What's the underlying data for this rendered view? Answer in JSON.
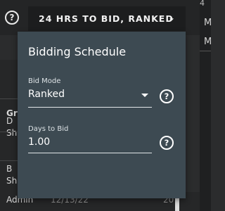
{
  "header": {
    "help_glyph": "?",
    "bid_button_label": "24 HRS TO BID, RANKED",
    "bid_button_chevron": "⌄"
  },
  "popup": {
    "title": "Bidding Schedule",
    "bid_mode": {
      "label": "Bid Mode",
      "value": "Ranked",
      "help_glyph": "?"
    },
    "days_to_bid": {
      "label": "Days to Bid",
      "value": "1.00",
      "help_glyph": "?"
    }
  },
  "background": {
    "left_column": {
      "header": "Gro",
      "rows": [
        {
          "line1": "D",
          "line2": "Sh"
        },
        {
          "line1": "B",
          "line2": "Sh"
        }
      ],
      "bottom": {
        "col1": "Admin",
        "col2": "12/13/22",
        "col3": "20"
      }
    },
    "right_column": {
      "top_digit": "4",
      "item1": "M",
      "item2": "M"
    }
  }
}
